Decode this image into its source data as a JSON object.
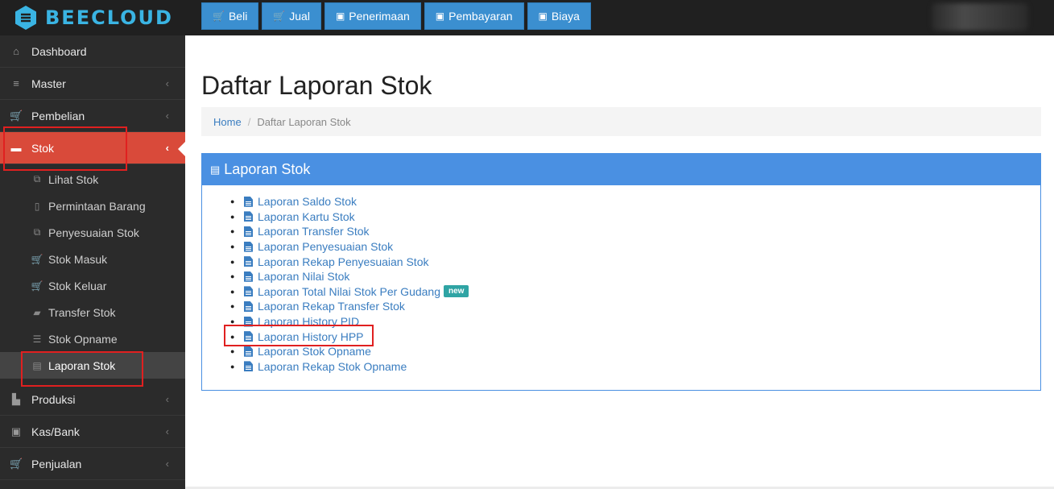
{
  "brand": {
    "name": "BEECLOUD",
    "color": "#3ab4e3"
  },
  "topnav": [
    {
      "label": "Beli",
      "icon": "cart-icon"
    },
    {
      "label": "Jual",
      "icon": "cart-icon"
    },
    {
      "label": "Penerimaan",
      "icon": "money-icon"
    },
    {
      "label": "Pembayaran",
      "icon": "money-icon"
    },
    {
      "label": "Biaya",
      "icon": "money-icon"
    }
  ],
  "sidebar": {
    "items": [
      {
        "label": "Dashboard",
        "icon": "home-icon"
      },
      {
        "label": "Master",
        "icon": "database-icon"
      },
      {
        "label": "Pembelian",
        "icon": "cart-icon"
      },
      {
        "label": "Stok",
        "icon": "box-icon"
      },
      {
        "label": "Produksi",
        "icon": "factory-icon"
      },
      {
        "label": "Kas/Bank",
        "icon": "money-icon"
      },
      {
        "label": "Penjualan",
        "icon": "cart-icon"
      }
    ],
    "stok_sub": [
      {
        "label": "Lihat Stok",
        "icon": "cubes-icon"
      },
      {
        "label": "Permintaan Barang",
        "icon": "file-icon"
      },
      {
        "label": "Penyesuaian Stok",
        "icon": "cubes-icon"
      },
      {
        "label": "Stok Masuk",
        "icon": "cart-icon"
      },
      {
        "label": "Stok Keluar",
        "icon": "cart-icon"
      },
      {
        "label": "Transfer Stok",
        "icon": "truck-icon"
      },
      {
        "label": "Stok Opname",
        "icon": "list-icon"
      },
      {
        "label": "Laporan Stok",
        "icon": "book-icon"
      }
    ]
  },
  "page": {
    "title": "Daftar Laporan Stok"
  },
  "breadcrumb": {
    "home": "Home",
    "current": "Daftar Laporan Stok"
  },
  "panel": {
    "title": "Laporan Stok",
    "reports": [
      "Laporan Saldo Stok",
      "Laporan Kartu Stok",
      "Laporan Transfer Stok",
      "Laporan Penyesuaian Stok",
      "Laporan Rekap Penyesuaian Stok",
      "Laporan Nilai Stok",
      "Laporan Total Nilai Stok Per Gudang",
      "Laporan Rekap Transfer Stok",
      "Laporan History PID",
      "Laporan History HPP",
      "Laporan Stok Opname",
      "Laporan Rekap Stok Opname"
    ],
    "new_badge": "new"
  },
  "colors": {
    "accent": "#3b8fd0",
    "active_menu": "#d94a3a",
    "panel_head": "#4a90e2",
    "highlight": "#e02020"
  }
}
